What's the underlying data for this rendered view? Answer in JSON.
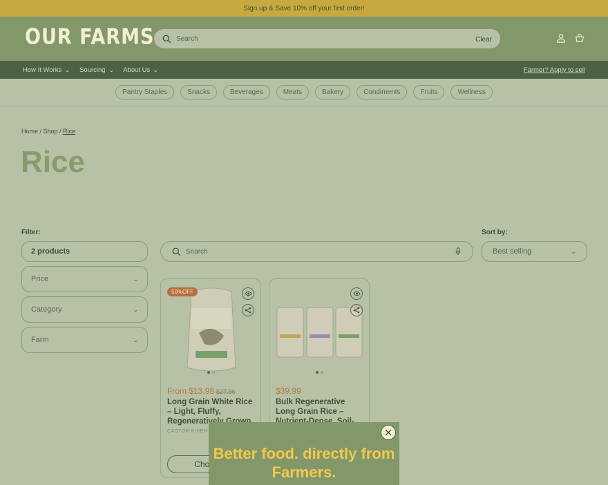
{
  "promo": {
    "text": "Sign up & Save 10% off your first order!"
  },
  "header": {
    "logo": "OUR FARMS",
    "search_placeholder": "Search",
    "clear_label": "Clear"
  },
  "nav": {
    "items": [
      {
        "label": "How It Works"
      },
      {
        "label": "Sourcing"
      },
      {
        "label": "About Us"
      }
    ],
    "apply_label": "Farmer? Apply to sell"
  },
  "categories": [
    "Pantry Staples",
    "Snacks",
    "Beverages",
    "Meats",
    "Bakery",
    "Condiments",
    "Fruits",
    "Wellness"
  ],
  "breadcrumb": {
    "home": "Home",
    "shop": "Shop",
    "current": "Rice",
    "sep": " / "
  },
  "page_title": "Rice",
  "filter": {
    "label": "Filter:",
    "count": "2 products",
    "price": "Price",
    "category": "Category",
    "farm": "Farm"
  },
  "sort": {
    "label": "Sort by:",
    "value": "Best selling"
  },
  "search_main": {
    "placeholder": "Search"
  },
  "products": [
    {
      "badge": "50%OFF",
      "price": "From $13.98",
      "compare": "$27.96",
      "title": "Long Grain White Rice – Light, Fluffy, Regeneratively Grown",
      "vendor": "CASTOR RIVER HA",
      "button": "Choose"
    },
    {
      "price": "$39.99",
      "title": "Bulk Regenerative Long Grain Rice – Nutrient-Dense, Soil-First"
    }
  ],
  "popup": {
    "heading": "Better food. directly from Farmers."
  },
  "colors": {
    "promo": "#c8a93f",
    "header": "#83986a",
    "nav": "#4b6344",
    "page": "#b6c1a6",
    "price": "#b6793d",
    "popup_heading": "#f2c94c"
  },
  "icons": [
    "search-icon",
    "account-icon",
    "cart-icon",
    "microphone-icon",
    "eye-icon",
    "share-icon",
    "close-icon"
  ]
}
